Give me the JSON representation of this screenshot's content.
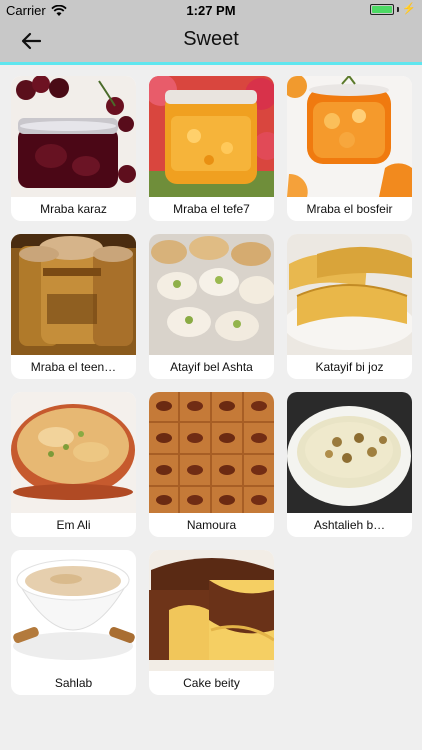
{
  "status_bar": {
    "carrier": "Carrier",
    "time": "1:27 PM",
    "icons": [
      "wifi-icon",
      "battery-icon",
      "charging-bolt-icon"
    ]
  },
  "nav": {
    "title": "Sweet",
    "back_icon": "arrow-left-icon"
  },
  "items": [
    {
      "label": "Mraba karaz"
    },
    {
      "label": "Mraba el tefe7"
    },
    {
      "label": "Mraba el bosfeir"
    },
    {
      "label": "Mraba el teen…"
    },
    {
      "label": "Atayif bel Ashta"
    },
    {
      "label": "Katayif bi joz"
    },
    {
      "label": "Em Ali"
    },
    {
      "label": "Namoura"
    },
    {
      "label": "Ashtalieh b…"
    },
    {
      "label": "Sahlab"
    },
    {
      "label": "Cake beity"
    }
  ],
  "colors": {
    "nav_background": "#c8c8c8",
    "nav_accent_line": "#5fe6ef",
    "page_background": "#efefef",
    "card_background": "#ffffff",
    "battery": "#4cd964"
  }
}
